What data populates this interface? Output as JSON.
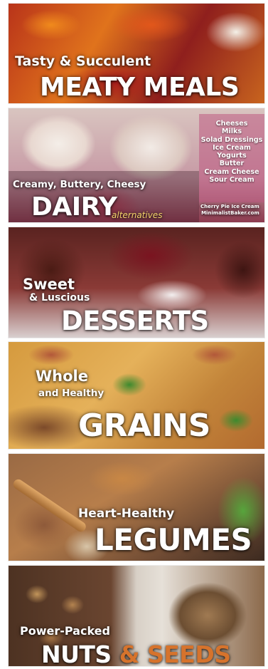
{
  "panels": {
    "meaty": {
      "subtitle": "Tasty & Succulent",
      "title": "MEATY MEALS"
    },
    "dairy": {
      "subtitle": "Creamy, Buttery, Cheesy",
      "title": "DAIRY",
      "title_suffix": "alternatives",
      "list": [
        "Cheeses",
        "Milks",
        "Solad Dressings",
        "Ice Cream",
        "Yogurts",
        "Butter",
        "Cream Cheese",
        "Sour Cream"
      ],
      "credit_line1": "Cherry Pie Ice Cream",
      "credit_line2": "MinimalistBaker.com"
    },
    "desserts": {
      "subtitle_line1": "Sweet",
      "subtitle_line2": "& Luscious",
      "title": "DESSERTS"
    },
    "grains": {
      "subtitle_line1": "Whole",
      "subtitle_line2": "and Healthy",
      "title": "GRAINS"
    },
    "legumes": {
      "subtitle": "Heart-Healthy",
      "title": "LEGUMES"
    },
    "nuts": {
      "subtitle": "Power-Packed",
      "title_part1": "NUTS",
      "title_part2": "& SEEDS"
    }
  },
  "colors": {
    "text": "#ffffff",
    "seeds_accent": "#d6732c"
  }
}
